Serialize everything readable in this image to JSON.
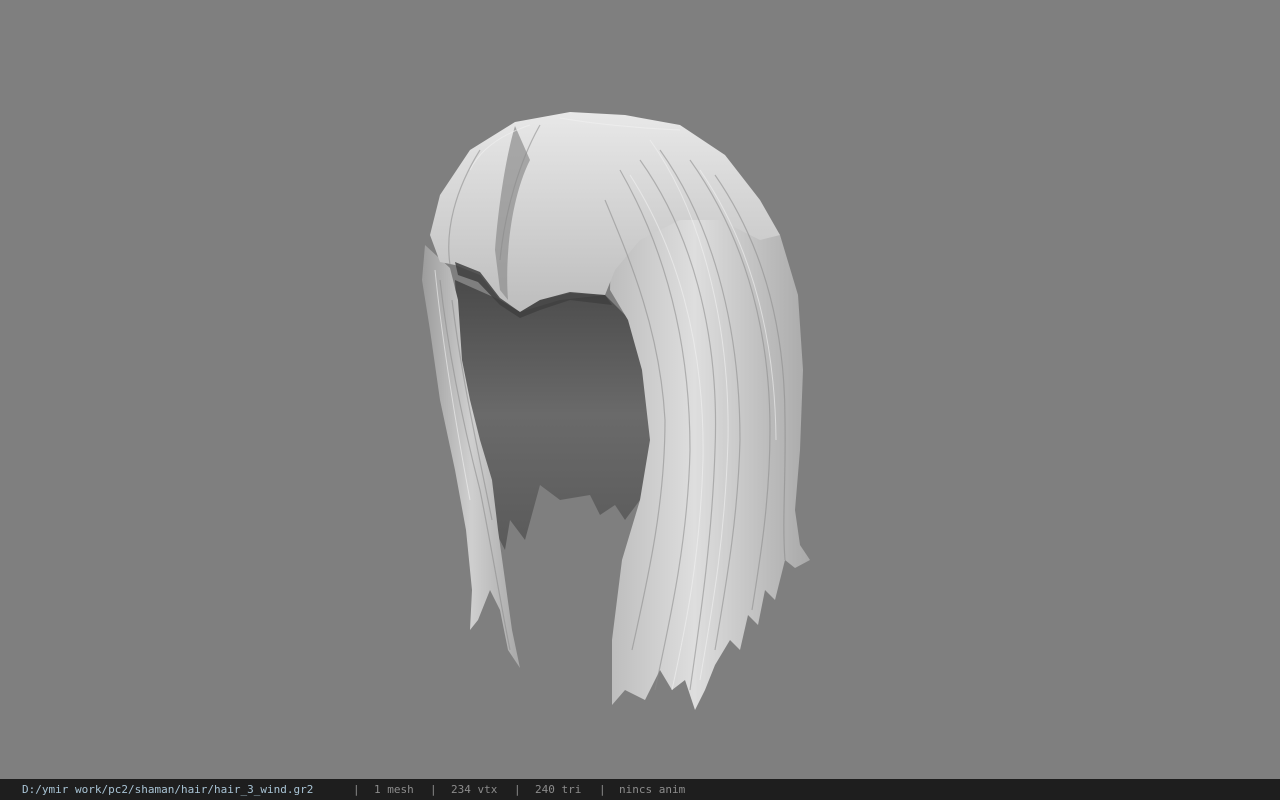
{
  "viewer": {
    "background_color": "#7f7f7f",
    "model_name": "hair-mesh"
  },
  "status_bar": {
    "file_path": "D:/ymir work/pc2/shaman/hair/hair_3_wind.gr2",
    "separator": "|",
    "mesh_count": "1 mesh",
    "vertex_count": "234 vtx",
    "triangle_count": "240 tri",
    "anim_status": "nincs anim",
    "path_color": "#a8c3d4",
    "text_color": "#8c8c8c",
    "bar_color": "#1e1e1e"
  }
}
